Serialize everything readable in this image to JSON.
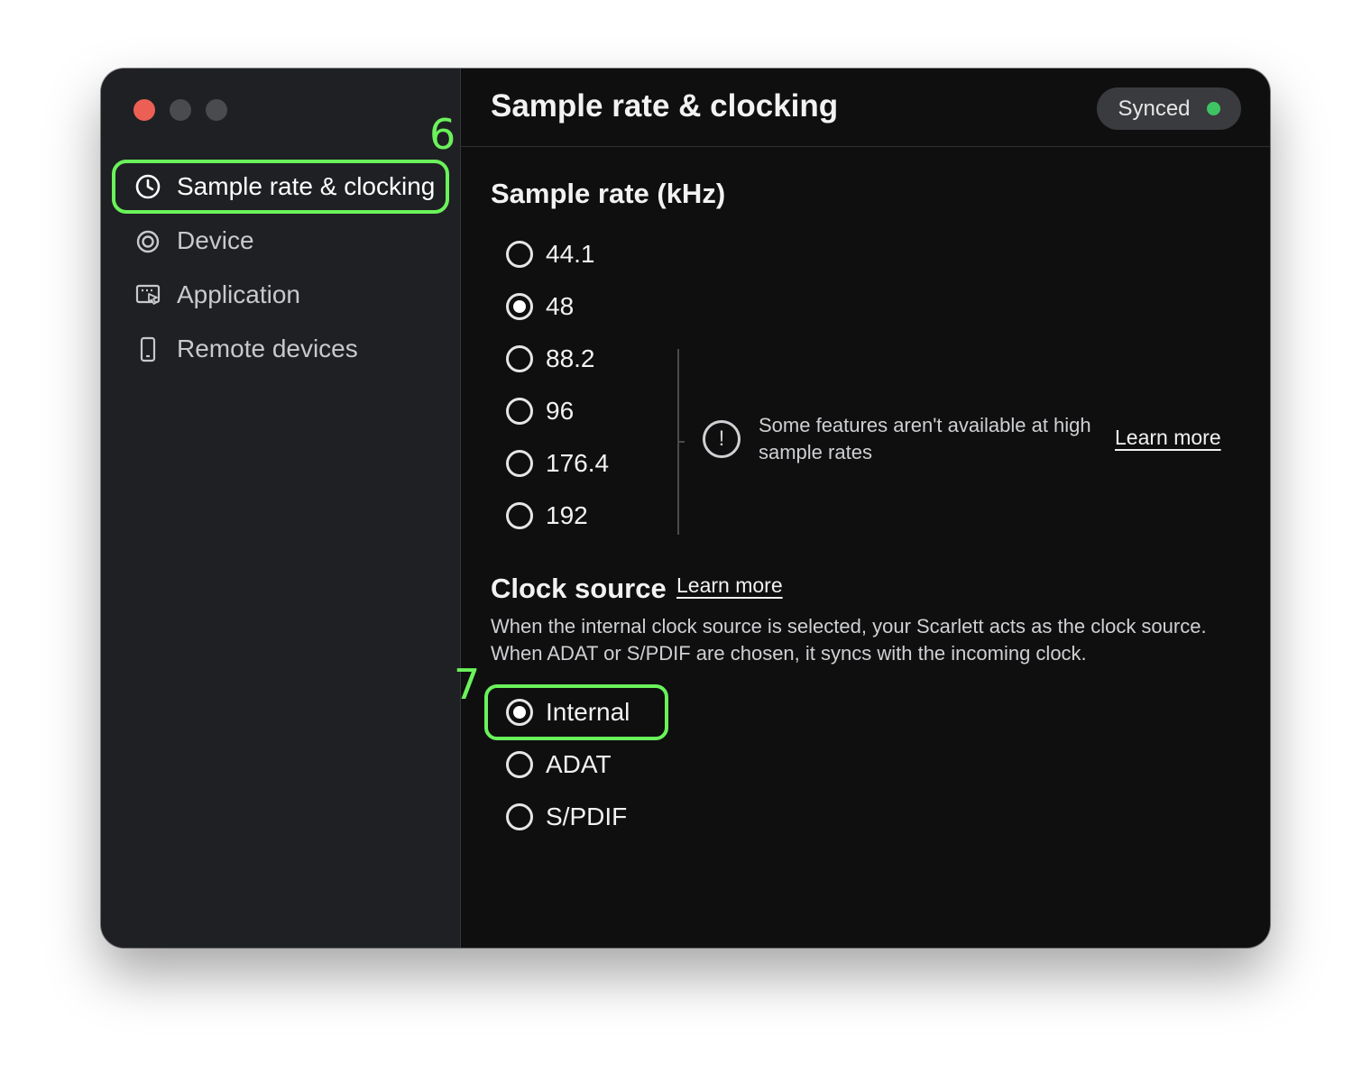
{
  "window": {
    "controls": [
      "close",
      "minimize",
      "zoom"
    ]
  },
  "sidebar": {
    "items": [
      {
        "label": "Sample rate & clocking",
        "icon": "clock-icon",
        "active": true
      },
      {
        "label": "Device",
        "icon": "device-icon",
        "active": false
      },
      {
        "label": "Application",
        "icon": "application-icon",
        "active": false
      },
      {
        "label": "Remote devices",
        "icon": "phone-icon",
        "active": false
      }
    ]
  },
  "callouts": {
    "six": "6",
    "seven": "7"
  },
  "header": {
    "title": "Sample rate & clocking",
    "status": "Synced",
    "status_color": "#3ec463"
  },
  "sample_rate": {
    "title": "Sample rate (kHz)",
    "options": [
      "44.1",
      "48",
      "88.2",
      "96",
      "176.4",
      "192"
    ],
    "selected": "48",
    "notice": "Some features aren't available at high sample rates",
    "learn_more": "Learn more"
  },
  "clock_source": {
    "title": "Clock source",
    "learn_more": "Learn more",
    "description": "When the internal clock source is selected, your Scarlett acts as the clock source. When ADAT or S/PDIF are chosen, it syncs with the incoming clock.",
    "options": [
      "Internal",
      "ADAT",
      "S/PDIF"
    ],
    "selected": "Internal"
  },
  "colors": {
    "highlight": "#6af25b",
    "sidebar_bg": "#1f2023",
    "main_bg": "#0f0f10"
  }
}
